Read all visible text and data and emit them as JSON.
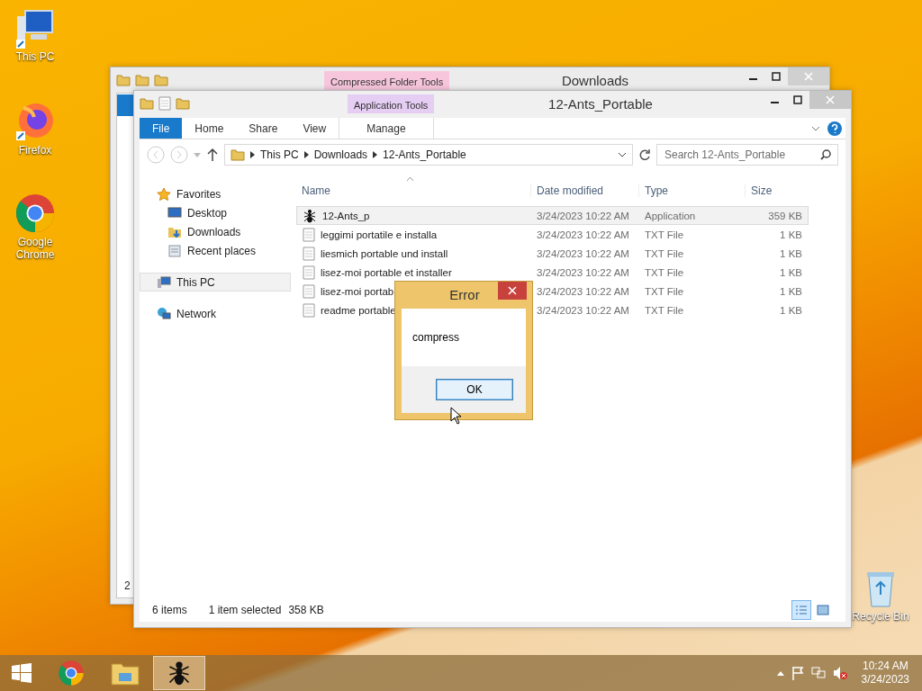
{
  "desktop_icons": [
    {
      "label": "This PC",
      "kind": "pc"
    },
    {
      "label": "Firefox",
      "kind": "firefox"
    },
    {
      "label": "Google Chrome",
      "kind": "chrome"
    }
  ],
  "recycle_bin": {
    "label": "Recycle Bin"
  },
  "back_window": {
    "title": "Downloads",
    "context_tab": "Compressed Folder Tools",
    "status_fragment": "2"
  },
  "front_window": {
    "title": "12-Ants_Portable",
    "context_tab": "Application Tools",
    "ribbon_tabs": [
      {
        "label": "File",
        "kind": "file"
      },
      {
        "label": "Home",
        "kind": "tab"
      },
      {
        "label": "Share",
        "kind": "tab"
      },
      {
        "label": "View",
        "kind": "tab"
      },
      {
        "label": "Manage",
        "kind": "context"
      }
    ],
    "breadcrumb": [
      "This PC",
      "Downloads",
      "12-Ants_Portable"
    ],
    "search": {
      "placeholder": "Search 12-Ants_Portable"
    },
    "nav": [
      {
        "label": "Favorites",
        "kind": "favorites",
        "selected": false,
        "children": [
          {
            "label": "Desktop",
            "kind": "desktop",
            "selected": false
          },
          {
            "label": "Downloads",
            "kind": "downloads",
            "selected": false
          },
          {
            "label": "Recent places",
            "kind": "recent",
            "selected": false
          }
        ]
      },
      {
        "label": "This PC",
        "kind": "pc",
        "selected": true
      },
      {
        "label": "Network",
        "kind": "network",
        "selected": false
      }
    ],
    "columns": [
      "Name",
      "Date modified",
      "Type",
      "Size"
    ],
    "rows": [
      {
        "kind": "app",
        "selected": true,
        "cells": [
          "12-Ants_p",
          "3/24/2023 10:22 AM",
          "Application",
          "359 KB"
        ]
      },
      {
        "kind": "txt",
        "selected": false,
        "cells": [
          "leggimi portatile e installa",
          "3/24/2023 10:22 AM",
          "TXT File",
          "1 KB"
        ]
      },
      {
        "kind": "txt",
        "selected": false,
        "cells": [
          "liesmich portable und install",
          "3/24/2023 10:22 AM",
          "TXT File",
          "1 KB"
        ]
      },
      {
        "kind": "txt",
        "selected": false,
        "cells": [
          "lisez-moi portable et installer",
          "3/24/2023 10:22 AM",
          "TXT File",
          "1 KB"
        ]
      },
      {
        "kind": "txt",
        "selected": false,
        "cells": [
          "lisez-moi portab",
          "3/24/2023 10:22 AM",
          "TXT File",
          "1 KB"
        ]
      },
      {
        "kind": "txt",
        "selected": false,
        "cells": [
          "readme portable",
          "3/24/2023 10:22 AM",
          "TXT File",
          "1 KB"
        ]
      }
    ],
    "status": {
      "count": "6 items",
      "selection": "1 item selected",
      "size": "358 KB"
    },
    "views": [
      {
        "kind": "details",
        "selected": true
      },
      {
        "kind": "large",
        "selected": false
      }
    ]
  },
  "dialog": {
    "title": "Error",
    "message": "compress",
    "button": "OK"
  },
  "taskbar": {
    "items": [
      {
        "kind": "chrome",
        "active": false
      },
      {
        "kind": "explorer",
        "active": false
      },
      {
        "kind": "ant",
        "active": true
      }
    ],
    "time": "10:24 AM",
    "date": "3/24/2023"
  }
}
